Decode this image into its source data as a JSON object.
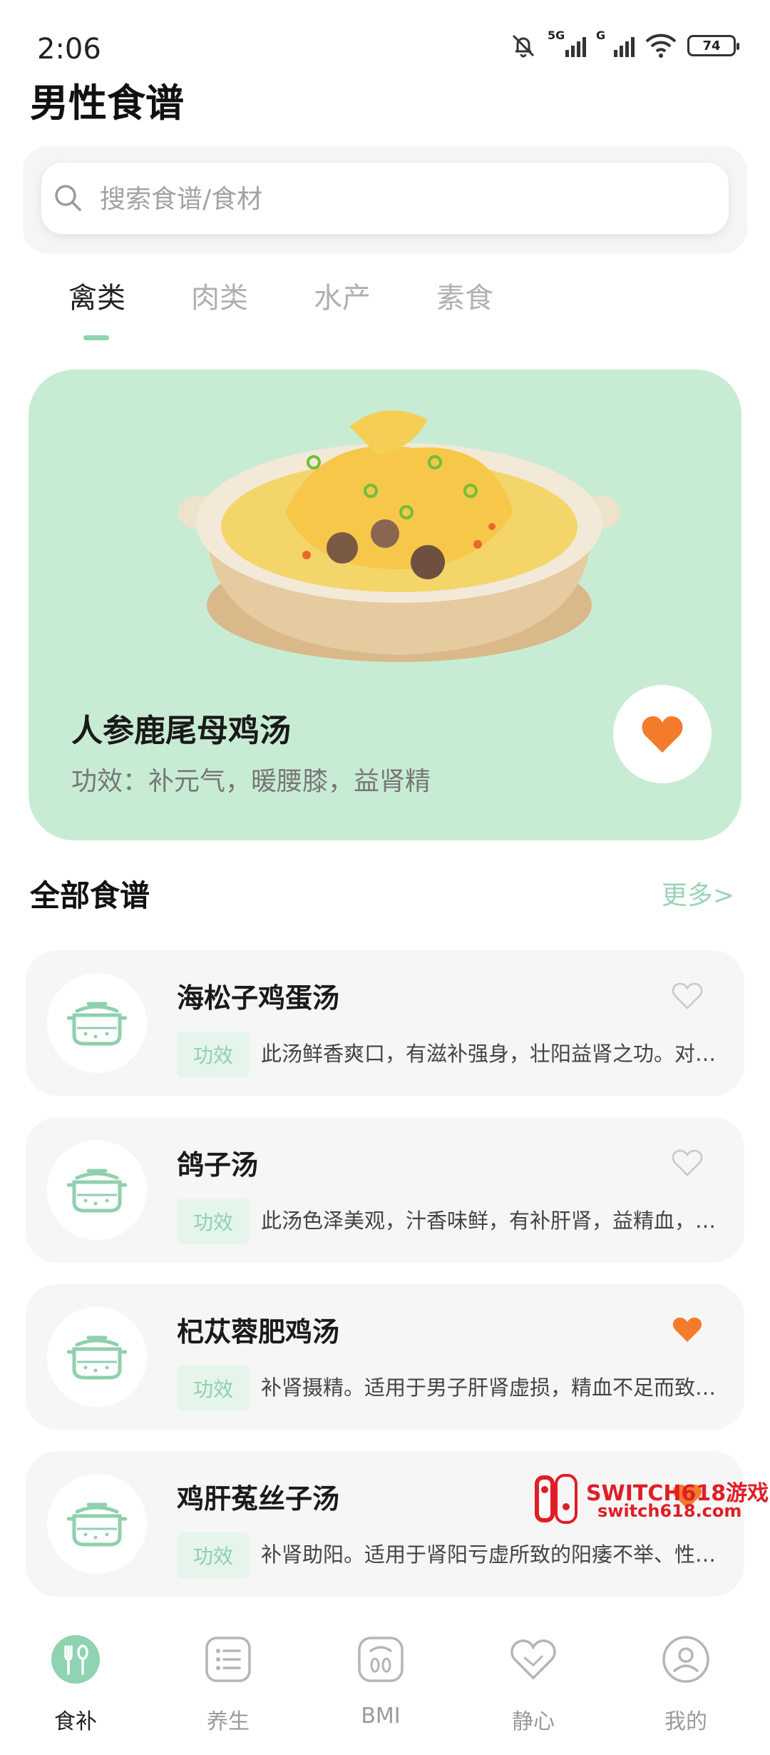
{
  "status_bar": {
    "time": "2:06",
    "signal1_label": "5G",
    "signal2_label": "G",
    "battery": "74"
  },
  "page_title": "男性食谱",
  "search": {
    "placeholder": "搜索食谱/食材"
  },
  "tabs": [
    {
      "label": "禽类",
      "active": true
    },
    {
      "label": "肉类",
      "active": false
    },
    {
      "label": "水产",
      "active": false
    },
    {
      "label": "素食",
      "active": false
    }
  ],
  "featured": {
    "name": "人参鹿尾母鸡汤",
    "effect": "功效：补元气，暖腰膝，益肾精",
    "liked": true,
    "image_icon": "chicken-soup-pot-illustration"
  },
  "section": {
    "title": "全部食谱",
    "more": "更多>"
  },
  "recipes": [
    {
      "name": "海松子鸡蛋汤",
      "tag": "功效",
      "desc": "此汤鲜香爽口，有滋补强身，壮阳益肾之功。对男子阳痿、遗精等有良好的辅助治疗作用。",
      "liked": false
    },
    {
      "name": "鸽子汤",
      "tag": "功效",
      "desc": "此汤色泽美观，汁香味鲜，有补肝肾，益精血，强筋骨之功效。",
      "liked": false
    },
    {
      "name": "杞苁蓉肥鸡汤",
      "tag": "功效",
      "desc": "补肾摄精。适用于男子肝肾虚损，精血不足而致的遗精、阳痿等症。",
      "liked": true
    },
    {
      "name": "鸡肝菟丝子汤",
      "tag": "功效",
      "desc": "补肾助阳。适用于肾阳亏虚所致的阳痿不举、性欲减退等症。",
      "liked": true
    }
  ],
  "watermark": {
    "title": "SWITCH618游戏",
    "url": "switch618.com"
  },
  "bottom_nav": [
    {
      "label": "食补",
      "icon": "fork-spoon-icon",
      "active": true
    },
    {
      "label": "养生",
      "icon": "list-icon",
      "active": false
    },
    {
      "label": "BMI",
      "icon": "scale-icon",
      "active": false
    },
    {
      "label": "静心",
      "icon": "heart-hand-icon",
      "active": false
    },
    {
      "label": "我的",
      "icon": "person-icon",
      "active": false
    }
  ],
  "colors": {
    "accent": "#8fd3b0",
    "featured_bg": "#c8ecd3",
    "heart": "#f47b2c"
  }
}
